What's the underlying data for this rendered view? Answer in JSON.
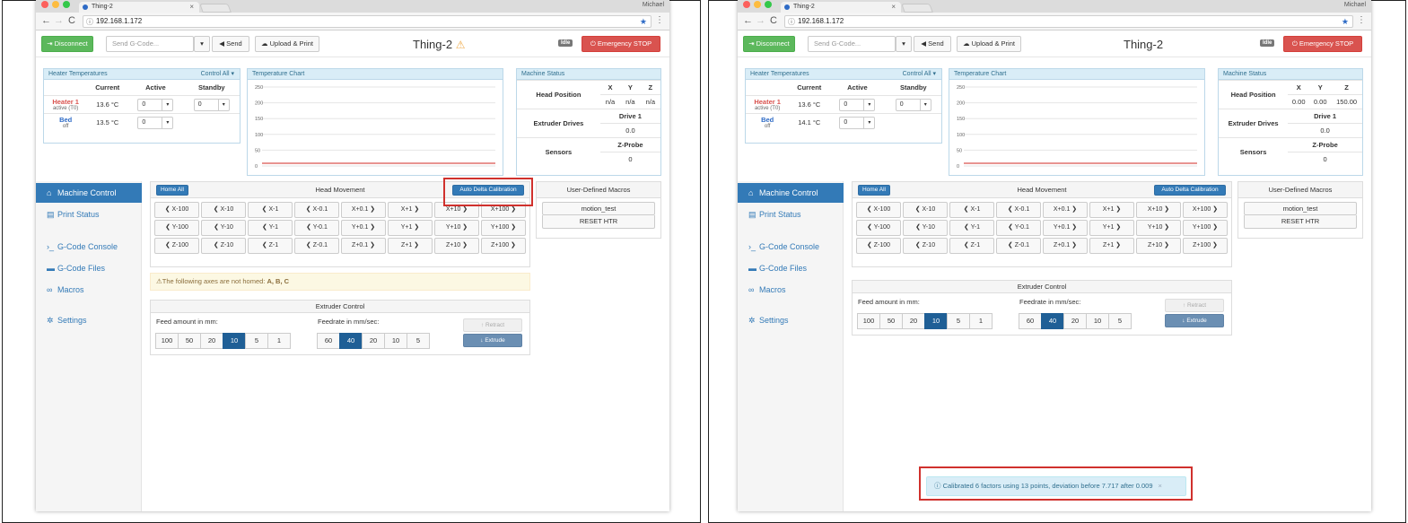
{
  "browser": {
    "tab_title": "Thing-2",
    "url": "192.168.1.172",
    "user_name": "Michael"
  },
  "toolbar": {
    "disconnect_label": "Disconnect",
    "gcode_placeholder": "Send G-Code...",
    "send_label": "Send",
    "upload_label": "Upload & Print",
    "machine_name": "Thing-2",
    "status_badge": "Idle",
    "emergency_label": "Emergency STOP"
  },
  "heater": {
    "title": "Heater Temperatures",
    "control_all": "Control All",
    "headers": [
      "Current",
      "Active",
      "Standby"
    ],
    "heater1_name": "Heater 1",
    "heater1_sub": "active (T0)",
    "bed_name": "Bed",
    "bed_sub": "off"
  },
  "chart": {
    "title": "Temperature Chart",
    "ticks": [
      "250",
      "200",
      "150",
      "100",
      "50",
      "0"
    ]
  },
  "status": {
    "title": "Machine Status",
    "head_position": "Head Position",
    "axes": [
      "X",
      "Y",
      "Z"
    ],
    "extruder_drives": "Extruder Drives",
    "drive1": "Drive 1",
    "drive_value": "0.0",
    "sensors": "Sensors",
    "zprobe": "Z-Probe",
    "zprobe_value": "0"
  },
  "sidebar": {
    "items": [
      {
        "label": "Machine Control",
        "icon": "home-icon"
      },
      {
        "label": "Print Status",
        "icon": "printer-icon"
      },
      {
        "label": "G-Code Console",
        "icon": "terminal-icon"
      },
      {
        "label": "G-Code Files",
        "icon": "hdd-icon"
      },
      {
        "label": "Macros",
        "icon": "link-icon"
      },
      {
        "label": "Settings",
        "icon": "cog-icon"
      }
    ]
  },
  "movement": {
    "home_all": "Home All",
    "title": "Head Movement",
    "auto_calibration": "Auto Delta Calibration",
    "rows": [
      [
        "X-100",
        "X-10",
        "X-1",
        "X-0.1",
        "X+0.1",
        "X+1",
        "X+10",
        "X+100"
      ],
      [
        "Y-100",
        "Y-10",
        "Y-1",
        "Y-0.1",
        "Y+0.1",
        "Y+1",
        "Y+10",
        "Y+100"
      ],
      [
        "Z-100",
        "Z-10",
        "Z-1",
        "Z-0.1",
        "Z+0.1",
        "Z+1",
        "Z+10",
        "Z+100"
      ]
    ]
  },
  "alert": {
    "text": "The following axes are not homed: ",
    "axes": "A, B, C"
  },
  "extruder": {
    "title": "Extruder Control",
    "feed_label": "Feed amount in mm:",
    "feed_options": [
      "100",
      "50",
      "20",
      "10",
      "5",
      "1"
    ],
    "feed_selected": "10",
    "rate_label": "Feedrate in mm/sec:",
    "rate_options": [
      "60",
      "40",
      "20",
      "10",
      "5"
    ],
    "rate_selected": "40",
    "retract": "Retract",
    "extrude": "Extrude"
  },
  "macros": {
    "title": "User-Defined Macros",
    "items": [
      "motion_test",
      "RESET HTR"
    ]
  },
  "left": {
    "heater1_current": "13.6 °C",
    "bed_current": "13.5 °C",
    "heater1_active": "0",
    "heater1_standby": "0",
    "bed_active": "0",
    "pos": [
      "n/a",
      "n/a",
      "n/a"
    ]
  },
  "right": {
    "heater1_current": "13.6 °C",
    "bed_current": "14.1 °C",
    "heater1_active": "0",
    "heater1_standby": "0",
    "bed_active": "0",
    "pos": [
      "0.00",
      "0.00",
      "150.00"
    ],
    "toast": "Calibrated 6 factors using 13 points, deviation before 7.717 after 0.009"
  },
  "colors": {
    "accent": "#337ab7",
    "highlight": "#d0312d",
    "heater_line": "#d9534f"
  }
}
